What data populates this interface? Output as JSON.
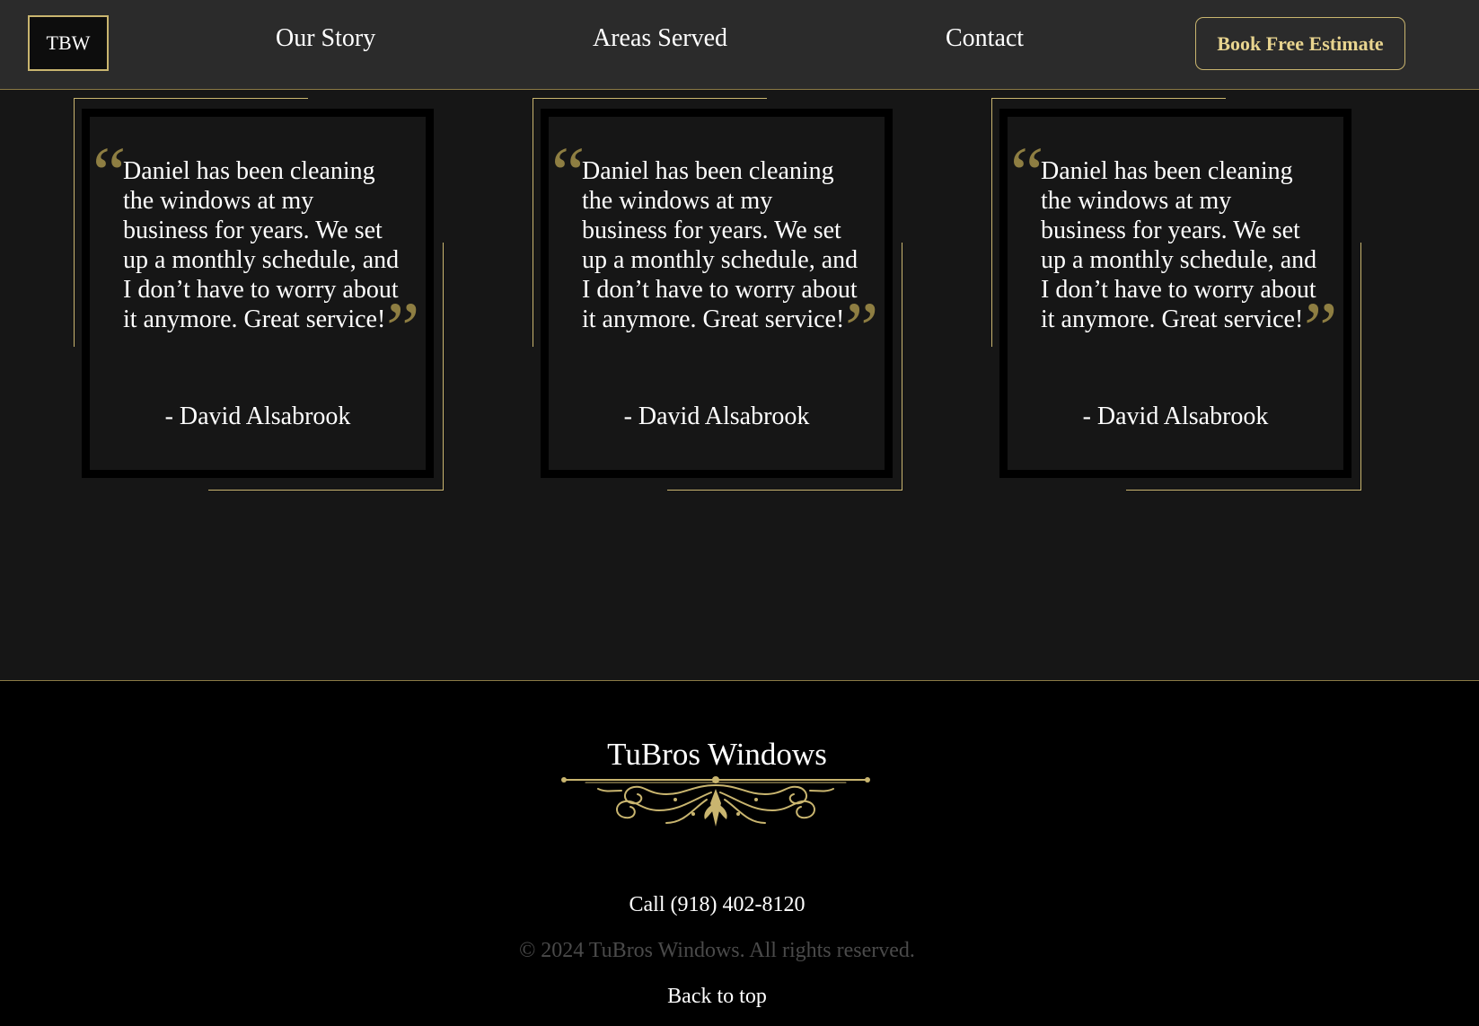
{
  "header": {
    "logo_text": "TBW",
    "nav": {
      "our_story": "Our Story",
      "areas_served": "Areas Served",
      "contact": "Contact"
    },
    "cta_label": "Book Free Estimate"
  },
  "testimonials": [
    {
      "quote": "Daniel has been cleaning the windows at my business for years. We set up a monthly schedule, and I don’t have to worry about it anymore. Great service!",
      "author": "- David Alsabrook",
      "open_mark": "“",
      "close_mark": "”"
    },
    {
      "quote": "Daniel has been cleaning the windows at my business for years. We set up a monthly schedule, and I don’t have to worry about it anymore. Great service!",
      "author": "- David Alsabrook",
      "open_mark": "“",
      "close_mark": "”"
    },
    {
      "quote": "Daniel has been cleaning the windows at my business for years. We set up a monthly schedule, and I don’t have to worry about it anymore. Great service!",
      "author": "- David Alsabrook",
      "open_mark": "“",
      "close_mark": "”"
    }
  ],
  "footer": {
    "brand": "TuBros Windows",
    "ornament_icon": "gold-flourish-divider",
    "phone": "Call  (918) 402-8120",
    "copyright": "© 2024 TuBros Windows. All rights reserved.",
    "back_to_top": "Back to top"
  },
  "colors": {
    "accent_gold": "#c9b56f",
    "cta_text": "#e8d48f",
    "quote_mark": "#8e7e42",
    "header_bg": "#2b2b2b",
    "page_bg": "#161616",
    "footer_bg": "#000000"
  }
}
